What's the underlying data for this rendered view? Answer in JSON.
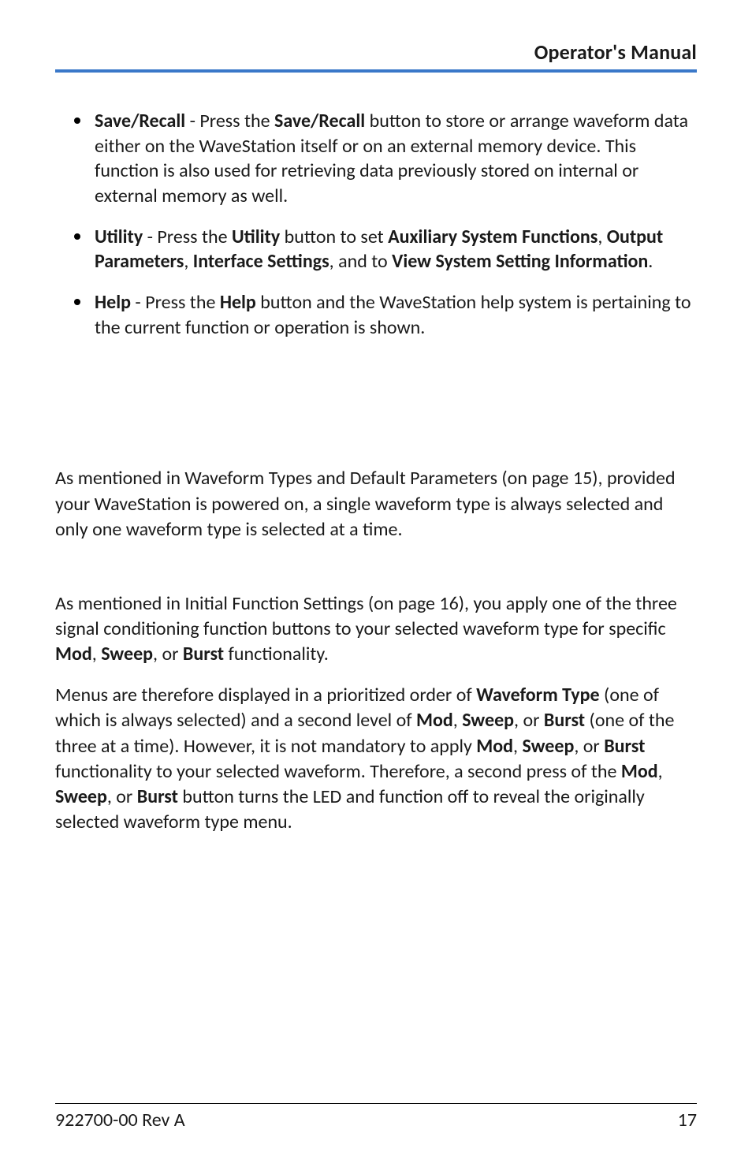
{
  "header": {
    "title": "Operator's Manual"
  },
  "bullets": [
    {
      "term": "Save/Recall",
      "sep": " - ",
      "pre": "Press the ",
      "b1": "Save/Recall",
      "post": " button to store or arrange waveform data either on the WaveStation itself or on an external memory device. This function is also used for retrieving data previously stored on internal or external memory as well."
    },
    {
      "term": "Utility",
      "sep": " - ",
      "p1": "Press the ",
      "b1": "Utility",
      "p2": " button to set ",
      "b2": "Auxiliary System Functions",
      "p3": ", ",
      "b3": "Output Parameters",
      "p4": ", ",
      "b4": "Interface Settings",
      "p5": ", and to ",
      "b5": "View System Setting Information",
      "p6": "."
    },
    {
      "term": "Help",
      "sep": " - ",
      "p1": "Press the ",
      "b1": "Help",
      "p2": " button and the WaveStation help system is pertaining to the current function or operation is shown."
    }
  ],
  "body": {
    "p1": "As mentioned in Waveform Types and Default Parameters (on page 15), provided your WaveStation is powered on, a single waveform type is always selected and only one waveform type is selected at a time.",
    "p2": {
      "s1": "As mentioned in Initial Function Settings (on page 16), you apply one of the three signal conditioning function buttons to your selected waveform type for specific ",
      "b1": "Mod",
      "s2": ", ",
      "b2": "Sweep",
      "s3": ", or ",
      "b3": "Burst",
      "s4": " functionality."
    },
    "p3": {
      "s1": "Menus are therefore displayed in a prioritized order of ",
      "b1": "Waveform Type",
      "s2": " (one of which is always selected) and a second level of ",
      "b2": "Mod",
      "s3": ", ",
      "b3": "Sweep",
      "s4": ", or ",
      "b4": "Burst",
      "s5": " (one of the three at a time). However, it is not mandatory to apply ",
      "b5": "Mod",
      "s6": ", ",
      "b6": "Sweep",
      "s7": ", or ",
      "b7": "Burst",
      "s8": " functionality to your selected waveform. Therefore, a second press of the ",
      "b8": "Mod",
      "s9": ", ",
      "b9": "Sweep",
      "s10": ", or ",
      "b10": "Burst",
      "s11": " button turns the LED and function off to reveal the originally selected waveform type menu."
    }
  },
  "footer": {
    "left": "922700-00 Rev A",
    "right": "17"
  }
}
